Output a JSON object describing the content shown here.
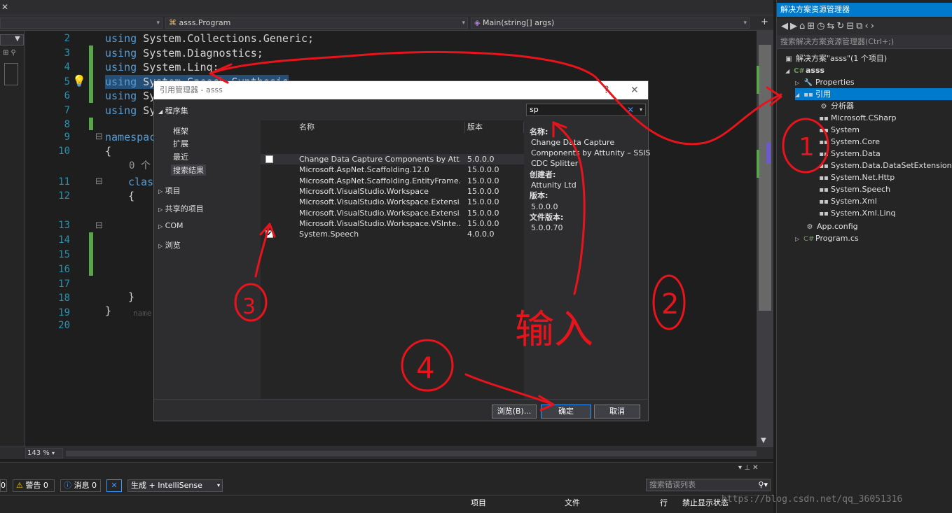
{
  "editor": {
    "tab_close": "✕",
    "nav_class": "asss.Program",
    "nav_member": "Main(string[] args)",
    "zoom": "143 %",
    "line_numbers": [
      "2",
      "3",
      "4",
      "5",
      "6",
      "7",
      "8",
      "9",
      "10",
      "11",
      "12",
      "13",
      "14",
      "15",
      "16",
      "17",
      "18",
      "19",
      "20"
    ],
    "code": [
      {
        "kw": "using",
        "rest": " System.Collections.Generic;"
      },
      {
        "kw": "using",
        "rest": " System.Diagnostics;"
      },
      {
        "kw": "using",
        "rest": " System.Linq;"
      },
      {
        "kw": "using",
        "rest": " System.Speech.Synthesis"
      },
      {
        "kw": "using",
        "rest": " Sy"
      },
      {
        "kw": "using",
        "rest": " Sy"
      }
    ],
    "namespace_kw": "namespace",
    "open_brace": "{",
    "close_brace": "}",
    "refs_hint": "0 个",
    "class_kw": "class",
    "name_hint": "name"
  },
  "error_list": {
    "errors_count": "0",
    "warnings": "警告 0",
    "messages": "消息 0",
    "build_filter": "生成 + IntelliSense",
    "search_placeholder": "搜索错误列表",
    "col_project": "项目",
    "col_file": "文件",
    "col_line": "行",
    "col_suppress": "禁止显示状态"
  },
  "solution_explorer": {
    "title": "解决方案资源管理器",
    "search_placeholder": "搜索解决方案资源管理器(Ctrl+;)",
    "solution": "解决方案\"asss\"(1 个项目)",
    "project": "asss",
    "properties": "Properties",
    "references": "引用",
    "ref_items": [
      "分析器",
      "Microsoft.CSharp",
      "System",
      "System.Core",
      "System.Data",
      "System.Data.DataSetExtensions",
      "System.Net.Http",
      "System.Speech",
      "System.Xml",
      "System.Xml.Linq"
    ],
    "app_config": "App.config",
    "program_cs": "Program.cs"
  },
  "dialog": {
    "title": "引用管理器 - asss",
    "help": "?",
    "close": "✕",
    "groups": {
      "assemblies": "程序集",
      "framework": "框架",
      "extensions": "扩展",
      "recent": "最近",
      "search_results": "搜索结果",
      "projects": "项目",
      "shared_projects": "共享的项目",
      "com": "COM",
      "browse": "浏览"
    },
    "columns": {
      "name": "名称",
      "version": "版本"
    },
    "rows": [
      {
        "name": "Change Data Capture Components by Att...",
        "version": "5.0.0.0",
        "checked": false
      },
      {
        "name": "Microsoft.AspNet.Scaffolding.12.0",
        "version": "15.0.0.0",
        "checked": false
      },
      {
        "name": "Microsoft.AspNet.Scaffolding.EntityFrame...",
        "version": "15.0.0.0",
        "checked": false
      },
      {
        "name": "Microsoft.VisualStudio.Workspace",
        "version": "15.0.0.0",
        "checked": false
      },
      {
        "name": "Microsoft.VisualStudio.Workspace.Extensi...",
        "version": "15.0.0.0",
        "checked": false
      },
      {
        "name": "Microsoft.VisualStudio.Workspace.Extensi...",
        "version": "15.0.0.0",
        "checked": false
      },
      {
        "name": "Microsoft.VisualStudio.Workspace.VSInte...",
        "version": "15.0.0.0",
        "checked": false
      },
      {
        "name": "System.Speech",
        "version": "4.0.0.0",
        "checked": true
      }
    ],
    "search_value": "sp",
    "details": {
      "name_label": "名称:",
      "name_line1": "Change Data Capture",
      "name_line2": "Components by Attunity – SSIS",
      "name_line3": "CDC Splitter",
      "creator_label": "创建者:",
      "creator": "Attunity Ltd",
      "version_label": "版本:",
      "version": "5.0.0.0",
      "file_version_label": "文件版本:",
      "file_version": "5.0.0.70"
    },
    "browse_button": "浏览(B)...",
    "ok_button": "确定",
    "cancel_button": "取消"
  },
  "annotations": {
    "n1": "1",
    "n2": "2",
    "n3": "3",
    "n4": "4",
    "input": "输入"
  },
  "watermark": "https://blog.csdn.net/qq_36051316",
  "colors": {
    "accent": "#007acc",
    "annotation": "#e8141c"
  }
}
